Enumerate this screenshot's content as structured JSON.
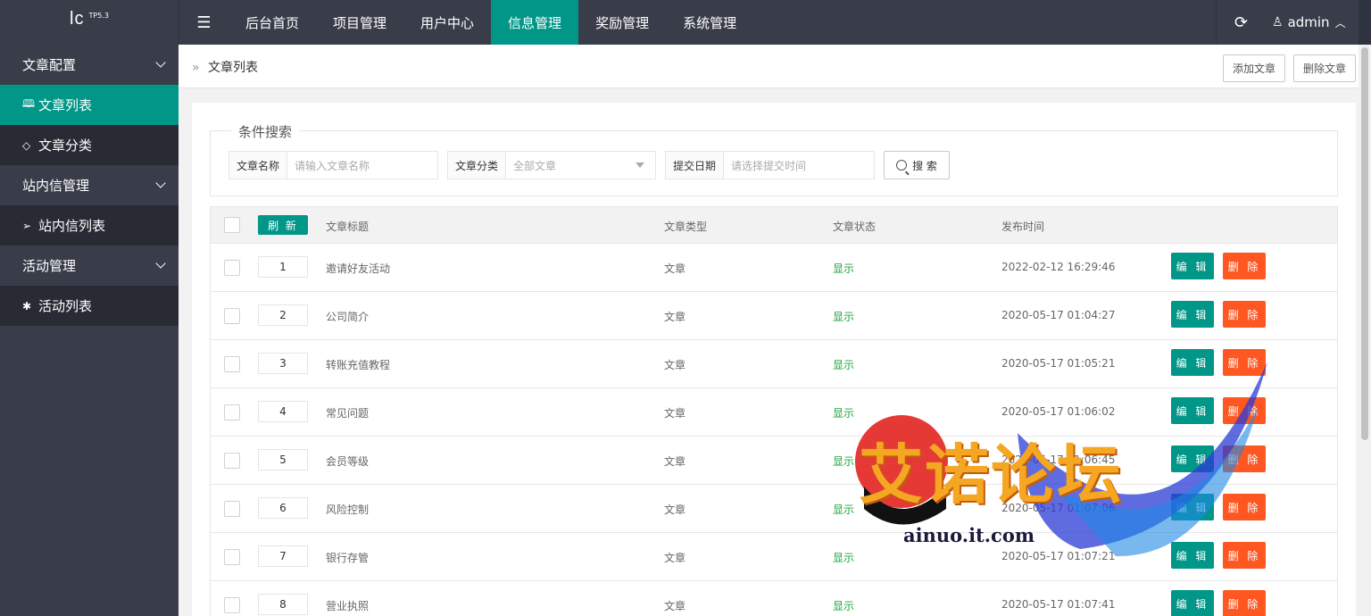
{
  "header": {
    "logo_main": "lc",
    "logo_version": "TP5.3",
    "nav": [
      {
        "label": "后台首页",
        "active": false
      },
      {
        "label": "项目管理",
        "active": false
      },
      {
        "label": "用户中心",
        "active": false
      },
      {
        "label": "信息管理",
        "active": true
      },
      {
        "label": "奖励管理",
        "active": false
      },
      {
        "label": "系统管理",
        "active": false
      }
    ],
    "user": "admin"
  },
  "sidebar": {
    "items": [
      {
        "label": "文章配置",
        "type": "parent",
        "icon": "",
        "expanded": true
      },
      {
        "label": "文章列表",
        "type": "child",
        "icon": "book-icon",
        "active": true
      },
      {
        "label": "文章分类",
        "type": "child",
        "icon": "tag-icon"
      },
      {
        "label": "站内信管理",
        "type": "parent",
        "icon": "",
        "expanded": true
      },
      {
        "label": "站内信列表",
        "type": "child",
        "icon": "send-icon"
      },
      {
        "label": "活动管理",
        "type": "parent",
        "icon": "",
        "expanded": true
      },
      {
        "label": "活动列表",
        "type": "child",
        "icon": "activity-icon"
      }
    ]
  },
  "breadcrumb": {
    "separator": "»",
    "current": "文章列表",
    "add_button": "添加文章",
    "delete_button": "删除文章"
  },
  "search": {
    "legend": "条件搜索",
    "name_label": "文章名称",
    "name_placeholder": "请输入文章名称",
    "category_label": "文章分类",
    "category_value": "全部文章",
    "date_label": "提交日期",
    "date_placeholder": "请选择提交时间",
    "search_button": "搜 索"
  },
  "table": {
    "refresh_button": "刷 新",
    "columns": [
      "文章标题",
      "文章类型",
      "文章状态",
      "发布时间"
    ],
    "rows": [
      {
        "index": "1",
        "title": "邀请好友活动",
        "type": "文章",
        "status": "显示",
        "time": "2022-02-12 16:29:46"
      },
      {
        "index": "2",
        "title": "公司简介",
        "type": "文章",
        "status": "显示",
        "time": "2020-05-17 01:04:27"
      },
      {
        "index": "3",
        "title": "转账充值教程",
        "type": "文章",
        "status": "显示",
        "time": "2020-05-17 01:05:21"
      },
      {
        "index": "4",
        "title": "常见问题",
        "type": "文章",
        "status": "显示",
        "time": "2020-05-17 01:06:02"
      },
      {
        "index": "5",
        "title": "会员等级",
        "type": "文章",
        "status": "显示",
        "time": "2020-05-17 01:06:45"
      },
      {
        "index": "6",
        "title": "风险控制",
        "type": "文章",
        "status": "显示",
        "time": "2020-05-17 01:07:06"
      },
      {
        "index": "7",
        "title": "银行存管",
        "type": "文章",
        "status": "显示",
        "time": "2020-05-17 01:07:21"
      },
      {
        "index": "8",
        "title": "营业执照",
        "type": "文章",
        "status": "显示",
        "time": "2020-05-17 01:07:41"
      }
    ],
    "edit_label": "编 辑",
    "delete_label": "删 除"
  },
  "watermark": {
    "title": "艾诺论坛",
    "url": "ainuo.it.com"
  },
  "colors": {
    "header_bg": "#393d49",
    "accent": "#009688",
    "danger": "#ff5722",
    "status_green": "#22a33a"
  }
}
